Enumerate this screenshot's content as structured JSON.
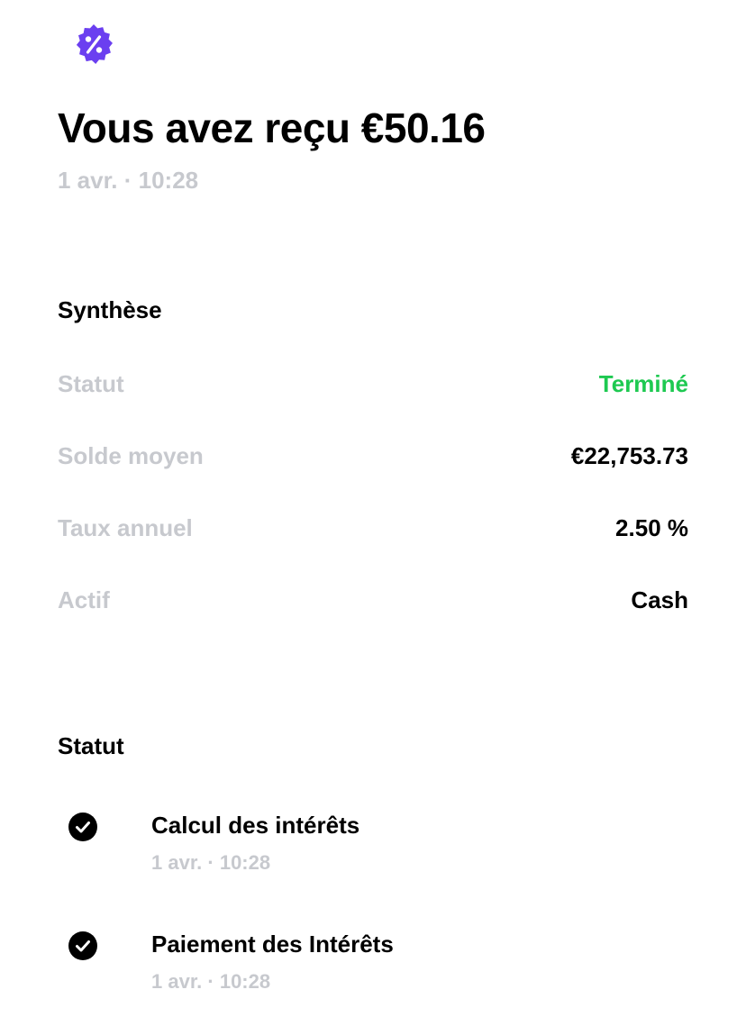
{
  "header": {
    "icon": "percent-badge-icon",
    "icon_color": "#6b3ff0",
    "title": "Vous avez reçu €50.16",
    "datetime": "1 avr. · 10:28"
  },
  "summary": {
    "heading": "Synthèse",
    "rows": [
      {
        "label": "Statut",
        "value": "Terminé",
        "value_color": "#1ec951"
      },
      {
        "label": "Solde moyen",
        "value": "€22,753.73"
      },
      {
        "label": "Taux annuel",
        "value": "2.50 %"
      },
      {
        "label": "Actif",
        "value": "Cash"
      }
    ]
  },
  "status": {
    "heading": "Statut",
    "steps": [
      {
        "icon": "check-circle-icon",
        "title": "Calcul des intérêts",
        "time": "1 avr. · 10:28"
      },
      {
        "icon": "check-circle-icon",
        "title": "Paiement des Intérêts",
        "time": "1 avr. · 10:28"
      }
    ]
  }
}
